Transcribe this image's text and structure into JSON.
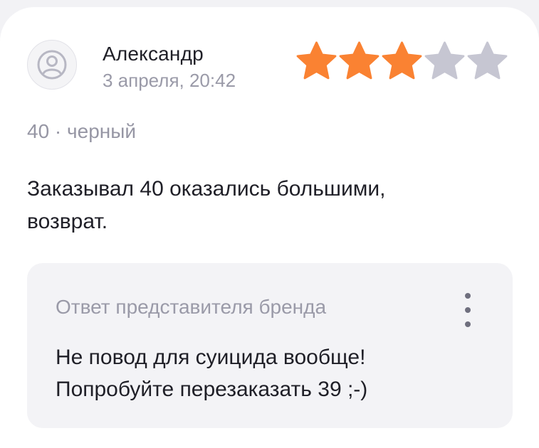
{
  "review": {
    "author": "Александр",
    "date": "3 апреля, 20:42",
    "rating": 3,
    "max_rating": 5,
    "variant": "40 · черный",
    "text_lines": [
      "Заказывал 40 оказались большими,",
      "возврат."
    ]
  },
  "brand_reply": {
    "title": "Ответ представителя бренда",
    "text_lines": [
      "Не повод для суицида вообще!",
      "Попробуйте перезаказать 39 ;-)"
    ],
    "menu_icon": "more-vertical-icon"
  },
  "icons": {
    "avatar": "user-icon",
    "star": "star-icon"
  },
  "colors": {
    "star_filled": "#fa8232",
    "star_empty": "#c6c6d2",
    "text_primary": "#1f1f27",
    "text_secondary": "#9a9aa8",
    "reply_background": "#f3f3f6"
  }
}
